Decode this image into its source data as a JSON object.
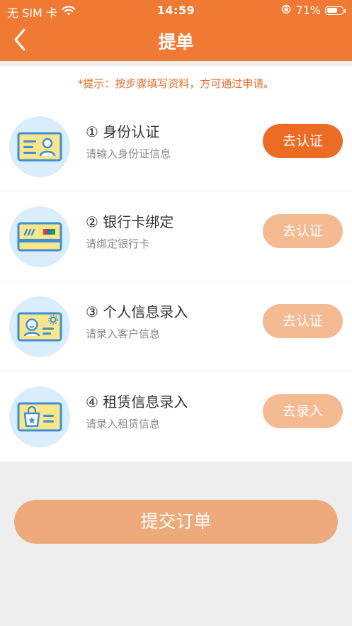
{
  "status_bar": {
    "carrier": "无 SIM 卡",
    "time": "14:59",
    "battery": "71%",
    "battery_level": 0.71
  },
  "nav": {
    "title": "提单",
    "back_icon": "chevron-left-icon"
  },
  "tip": "*提示：按步骤填写资料，方可通过申请。",
  "steps": [
    {
      "title": "① 身份认证",
      "subtitle": "请输入身份证信息",
      "button": "去认证",
      "active": true,
      "icon": "id-card-icon"
    },
    {
      "title": "② 银行卡绑定",
      "subtitle": "请绑定银行卡",
      "button": "去认证",
      "active": false,
      "icon": "bank-card-icon"
    },
    {
      "title": "③ 个人信息录入",
      "subtitle": "请录入客户信息",
      "button": "去认证",
      "active": false,
      "icon": "personal-info-icon"
    },
    {
      "title": "④ 租赁信息录入",
      "subtitle": "请录入租赁信息",
      "button": "去录入",
      "active": false,
      "icon": "lease-info-icon"
    }
  ],
  "submit_label": "提交订单",
  "colors": {
    "brand": "#f07a33",
    "button_active": "#ec6c26",
    "button_inactive": "#f4bb93",
    "submit": "#efaa7c"
  }
}
